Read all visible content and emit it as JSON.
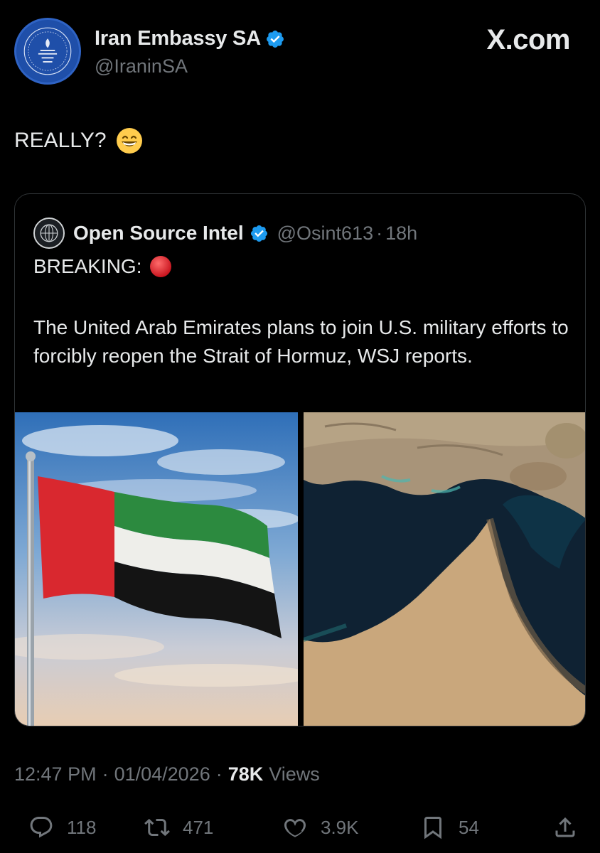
{
  "author": {
    "display_name": "Iran Embassy SA",
    "handle": "@IraninSA",
    "avatar_icon": "embassy-seal-icon",
    "verified": true
  },
  "brand": "X.com",
  "tweet": {
    "text": "REALLY?",
    "emoji": "grinning-face-with-smiling-eyes"
  },
  "quoted_tweet": {
    "display_name": "Open Source Intel",
    "handle": "@Osint613",
    "separator": "·",
    "time": "18h",
    "breaking_label": "BREAKING:",
    "body": "The United Arab Emirates plans to join U.S. military efforts to forcibly reopen the Strait of Hormuz, WSJ reports.",
    "media": [
      {
        "name": "uae-flag-image",
        "kind": "photo"
      },
      {
        "name": "strait-of-hormuz-satellite-image",
        "kind": "photo"
      }
    ]
  },
  "meta": {
    "time": "12:47 PM",
    "date": "01/04/2026",
    "separator": "·",
    "views_count": "78K",
    "views_label": "Views"
  },
  "actions": {
    "reply_count": "118",
    "repost_count": "471",
    "like_count": "3.9K",
    "bookmark_count": "54"
  },
  "colors": {
    "background": "#000000",
    "text": "#e7e9ea",
    "muted": "#71767b",
    "border": "#2f3336",
    "verified": "#1d9bf0"
  }
}
